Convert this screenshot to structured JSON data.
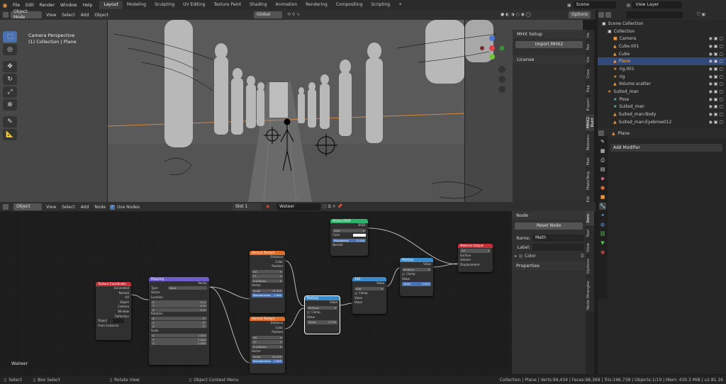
{
  "topbar": {
    "menus": [
      "File",
      "Edit",
      "Render",
      "Window",
      "Help"
    ],
    "workspaces": [
      "Layout",
      "Modeling",
      "Sculpting",
      "UV Editing",
      "Texture Paint",
      "Shading",
      "Animation",
      "Rendering",
      "Compositing",
      "Scripting"
    ],
    "plus": "+",
    "scene_label": "Scene",
    "viewlayer_label": "View Layer"
  },
  "viewport": {
    "mode": "Object Mode",
    "menus": [
      "View",
      "Select",
      "Add",
      "Object"
    ],
    "orientation": "Global",
    "overlay1": "Camera Perspective",
    "overlay2": "(1) Collection | Plane",
    "options": "Options"
  },
  "npanel": {
    "mhx_title": "MHX Setup",
    "import_btn": "Import MHX2",
    "license": "License",
    "tabs": [
      "Ite",
      "Too",
      "Vie",
      "Crea",
      "Pap",
      "Experi",
      "MHX2 Runt",
      "Makewu",
      "Mak",
      "MakeTarg",
      "Edi"
    ]
  },
  "outliner": {
    "search": "",
    "rows": [
      {
        "name": "Scene Collection",
        "indent": 0,
        "icon": "▣",
        "ic": "#ddd"
      },
      {
        "name": "Collection",
        "indent": 1,
        "icon": "▣",
        "ic": "#ddd"
      },
      {
        "name": "Camera",
        "indent": 2,
        "icon": "■",
        "ic": "#e8963c"
      },
      {
        "name": "Cube.001",
        "indent": 2,
        "icon": "▲",
        "ic": "#e8963c"
      },
      {
        "name": "Cube",
        "indent": 2,
        "icon": "▲",
        "ic": "#e8963c"
      },
      {
        "name": "Plane",
        "indent": 2,
        "icon": "▲",
        "ic": "#e8963c",
        "sel": true
      },
      {
        "name": "rig.001",
        "indent": 2,
        "icon": "★",
        "ic": "#e8963c"
      },
      {
        "name": "rig",
        "indent": 2,
        "icon": "★",
        "ic": "#e8963c"
      },
      {
        "name": "Volume scatter",
        "indent": 2,
        "icon": "▲",
        "ic": "#e8963c"
      },
      {
        "name": "Suited_man",
        "indent": 1,
        "icon": "★",
        "ic": "#e8963c"
      },
      {
        "name": "Pose",
        "indent": 2,
        "icon": "★",
        "ic": "#5ec3c3"
      },
      {
        "name": "Suited_man",
        "indent": 2,
        "icon": "★",
        "ic": "#5ec3c3"
      },
      {
        "name": "Suited_man:Body",
        "indent": 2,
        "icon": "▲",
        "ic": "#e8963c"
      },
      {
        "name": "Suited_man:Eyebrow012",
        "indent": 2,
        "icon": "▲",
        "ic": "#e8963c"
      }
    ]
  },
  "properties": {
    "object_name": "Plane",
    "add_modifier": "Add Modifier"
  },
  "node_editor": {
    "editor": "Object",
    "menus": [
      "View",
      "Select",
      "Add",
      "Node"
    ],
    "use_nodes": "Use Nodes",
    "slot": "Slot 1",
    "material": "Wateer",
    "mat_label": "Wateer",
    "nodes": {
      "texcoord": {
        "title": "Texture Coordinate",
        "outs": [
          "Generated",
          "Normal",
          "UV",
          "Object",
          "Camera",
          "Window",
          "Reflection"
        ],
        "object": "Object",
        "instancer": "From Instancer"
      },
      "mapping": {
        "title": "Mapping",
        "out": "Vector",
        "type_label": "Type:",
        "type": "Point",
        "vector": "Vector",
        "location": "Location",
        "rotation": "Rotation",
        "scale": "Scale",
        "loc": [
          [
            "X",
            "0 m"
          ],
          [
            "Y",
            "0 m"
          ],
          [
            "Z",
            "0 m"
          ]
        ],
        "rot": [
          [
            "X",
            "0°"
          ],
          [
            "Y",
            "0°"
          ],
          [
            "Z",
            "0°"
          ]
        ],
        "scl": [
          [
            "X",
            "1.000"
          ],
          [
            "Y",
            "7.000"
          ],
          [
            "Z",
            "1.000"
          ]
        ]
      },
      "voronoi1": {
        "title": "Voronoi Texture",
        "outs": [
          "Distance",
          "Color",
          "Position"
        ],
        "dim": "3D",
        "feat": "F1",
        "metric": "Euclidean",
        "vector": "Vector",
        "scale_l": "Scale",
        "scale": "25.000",
        "rand_l": "Randomness",
        "rand": "1.000"
      },
      "voronoi2": {
        "title": "Voronoi Texture",
        "outs": [
          "Distance",
          "Color",
          "Position"
        ],
        "dim": "3D",
        "feat": "F1",
        "metric": "Euclidean",
        "vector": "Vector",
        "scale_l": "Scale",
        "scale": "40.000",
        "rand_l": "Randomness",
        "rand": "1.000"
      },
      "glossy": {
        "title": "Glossy BSDF",
        "out": "BSDF",
        "dist": "GGX",
        "color": "Color",
        "rough_l": "Roughness",
        "rough": "0.100",
        "normal": "Normal"
      },
      "mult1": {
        "title": "Multiply",
        "out": "Value",
        "op": "Multiply",
        "clamp": "Clamp",
        "value": "Value",
        "val_l": "Value",
        "val": "0.750"
      },
      "add": {
        "title": "Add",
        "out": "Value",
        "op": "Add",
        "clamp": "Clamp",
        "value": "Value",
        "value2": "Value"
      },
      "mult2": {
        "title": "Multiply",
        "out": "Value",
        "op": "Multiply",
        "clamp": "Clamp",
        "value": "Value",
        "val_l": "Value",
        "val": "0.004"
      },
      "matout": {
        "title": "Material Output",
        "target": "All",
        "ins": [
          "Surface",
          "Volume",
          "Displacement"
        ]
      }
    }
  },
  "node_panel": {
    "title": "Node",
    "reset": "Reset Node",
    "name_l": "Name:",
    "name": "Math",
    "label_l": "Label:",
    "label": "",
    "color": "Color",
    "properties": "Properties",
    "tabs": [
      "Item",
      "Tool",
      "View",
      "Options",
      "Node Wrangler"
    ]
  },
  "status": {
    "select": "Select",
    "box": "Box Select",
    "rotate": "Rotate View",
    "ctx": "Object Context Menu",
    "stats": "Collection | Plane | Verts:99,434 | Faces:98,369 | Tris:196,738 | Objects:1/19 | Mem: 430.3 MiB | v2.81.16"
  },
  "colors": {
    "accent": "#4772b3",
    "node_texture": "#e06c2a",
    "node_shader": "#2bb36a",
    "node_vector": "#6c5ccc",
    "node_converter": "#3b8ac9",
    "node_output": "#c4313b",
    "node_input": "#c4313b"
  }
}
